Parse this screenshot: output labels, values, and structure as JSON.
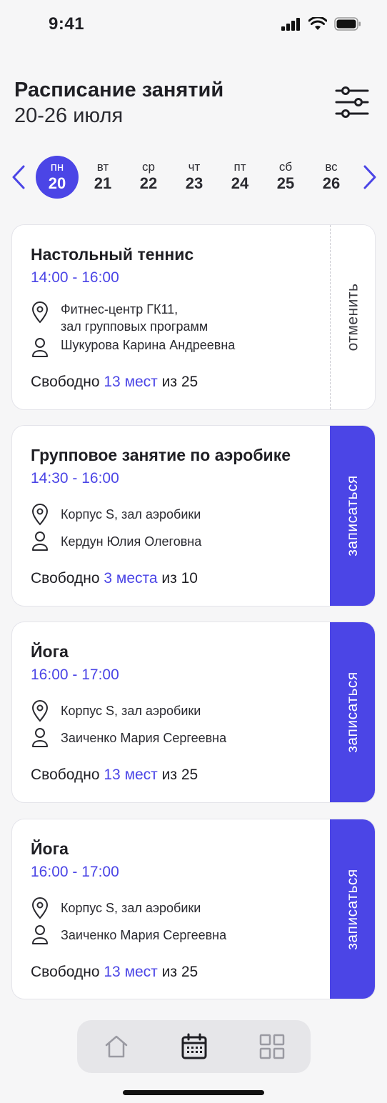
{
  "status_bar": {
    "time": "9:41"
  },
  "header": {
    "title": "Расписание занятий",
    "subtitle": "20-26 июля"
  },
  "week": {
    "days": [
      {
        "dow": "пн",
        "num": "20",
        "active": true
      },
      {
        "dow": "вт",
        "num": "21"
      },
      {
        "dow": "ср",
        "num": "22"
      },
      {
        "dow": "чт",
        "num": "23"
      },
      {
        "dow": "пт",
        "num": "24"
      },
      {
        "dow": "сб",
        "num": "25"
      },
      {
        "dow": "вс",
        "num": "26"
      }
    ]
  },
  "classes": [
    {
      "title": "Настольный теннис",
      "time": "14:00 - 16:00",
      "location": "Фитнес-центр ГК11,\nзал групповых программ",
      "trainer": "Шукурова Карина Андреевна",
      "seats_prefix": "Свободно ",
      "seats_count": "13 мест",
      "seats_suffix": " из 25",
      "action": "отменить",
      "action_type": "cancel"
    },
    {
      "title": "Групповое занятие по аэробике",
      "time": "14:30 - 16:00",
      "location": "Корпус S, зал аэробики",
      "trainer": "Кердун Юлия Олеговна",
      "seats_prefix": "Свободно ",
      "seats_count": "3 места",
      "seats_suffix": " из 10",
      "action": "записаться",
      "action_type": "signup"
    },
    {
      "title": "Йога",
      "time": "16:00 - 17:00",
      "location": "Корпус S, зал аэробики",
      "trainer": "Заиченко Мария Сергеевна",
      "seats_prefix": "Свободно ",
      "seats_count": "13 мест",
      "seats_suffix": " из 25",
      "action": "записаться",
      "action_type": "signup"
    },
    {
      "title": "Йога",
      "time": "16:00 - 17:00",
      "location": "Корпус S, зал аэробики",
      "trainer": "Заиченко Мария Сергеевна",
      "seats_prefix": "Свободно ",
      "seats_count": "13 мест",
      "seats_suffix": " из 25",
      "action": "записаться",
      "action_type": "signup"
    }
  ],
  "bottom_nav": {
    "items": [
      {
        "icon": "home-icon"
      },
      {
        "icon": "calendar-icon",
        "active": true
      },
      {
        "icon": "grid-icon"
      }
    ]
  },
  "colors": {
    "accent": "#4b45e6",
    "background": "#f6f6f7",
    "card": "#ffffff",
    "text": "#1f1f24"
  }
}
